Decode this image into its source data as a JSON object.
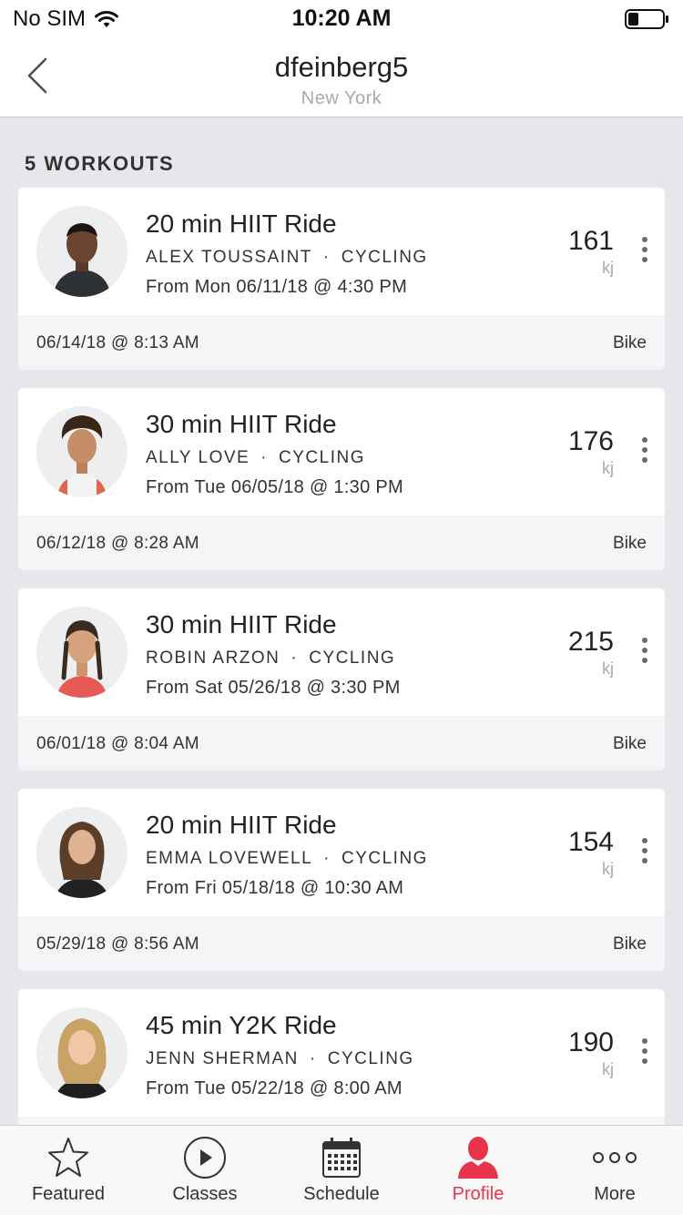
{
  "status_bar": {
    "carrier": "No SIM",
    "time": "10:20 AM"
  },
  "header": {
    "title": "dfeinberg5",
    "subtitle": "New York"
  },
  "section": {
    "title": "5 WORKOUTS"
  },
  "workouts": [
    {
      "title": "20 min HIIT Ride",
      "instructor": "ALEX TOUSSAINT",
      "discipline": "CYCLING",
      "from": "From Mon 06/11/18 @ 4:30 PM",
      "output": "161",
      "unit": "kj",
      "date": "06/14/18 @ 8:13 AM",
      "device": "Bike"
    },
    {
      "title": "30 min HIIT Ride",
      "instructor": "ALLY LOVE",
      "discipline": "CYCLING",
      "from": "From Tue 06/05/18 @ 1:30 PM",
      "output": "176",
      "unit": "kj",
      "date": "06/12/18 @ 8:28 AM",
      "device": "Bike"
    },
    {
      "title": "30 min HIIT Ride",
      "instructor": "ROBIN ARZON",
      "discipline": "CYCLING",
      "from": "From Sat 05/26/18 @ 3:30 PM",
      "output": "215",
      "unit": "kj",
      "date": "06/01/18 @ 8:04 AM",
      "device": "Bike"
    },
    {
      "title": "20 min HIIT Ride",
      "instructor": "EMMA LOVEWELL",
      "discipline": "CYCLING",
      "from": "From Fri 05/18/18 @ 10:30 AM",
      "output": "154",
      "unit": "kj",
      "date": "05/29/18 @ 8:56 AM",
      "device": "Bike"
    },
    {
      "title": "45 min Y2K Ride",
      "instructor": "JENN SHERMAN",
      "discipline": "CYCLING",
      "from": "From Tue 05/22/18 @ 8:00 AM",
      "output": "190",
      "unit": "kj",
      "date": "",
      "device": ""
    }
  ],
  "tabs": [
    {
      "label": "Featured",
      "icon": "star-icon"
    },
    {
      "label": "Classes",
      "icon": "play-circle-icon"
    },
    {
      "label": "Schedule",
      "icon": "calendar-icon"
    },
    {
      "label": "Profile",
      "icon": "person-icon",
      "active": true
    },
    {
      "label": "More",
      "icon": "more-horizontal-icon"
    }
  ],
  "colors": {
    "accent": "#e8334a",
    "background": "#e5e7ea",
    "card": "#ffffff",
    "card_footer": "#f4f5f7"
  }
}
